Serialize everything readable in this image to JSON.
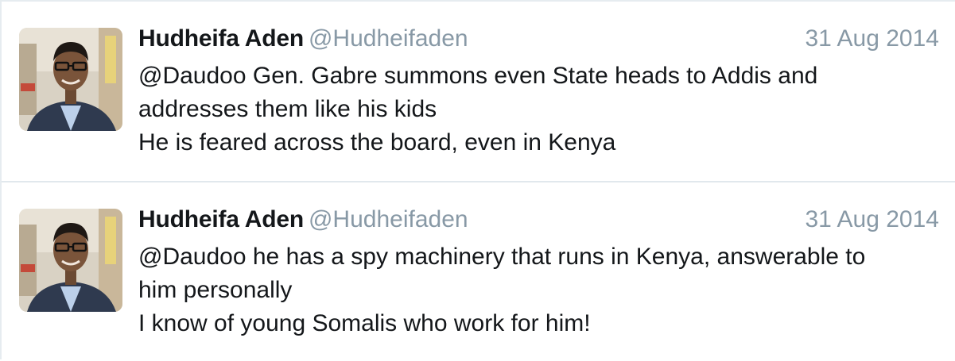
{
  "tweets": [
    {
      "author": {
        "display_name": "Hudheifa Aden",
        "handle": "@Hudheifaden",
        "avatar_icon": "profile-photo"
      },
      "date": "31 Aug 2014",
      "lines": [
        "@Daudoo Gen. Gabre summons even State heads to Addis and",
        "addresses them like his kids",
        "He is feared across the board, even in Kenya"
      ]
    },
    {
      "author": {
        "display_name": "Hudheifa Aden",
        "handle": "@Hudheifaden",
        "avatar_icon": "profile-photo"
      },
      "date": "31 Aug 2014",
      "lines": [
        "@Daudoo he has a spy machinery that runs in Kenya, answerable to",
        "him personally",
        "I know of young Somalis who work for him!"
      ]
    }
  ],
  "colors": {
    "text": "#14171a",
    "muted": "#8899a6",
    "divider": "#e1e8ed"
  }
}
